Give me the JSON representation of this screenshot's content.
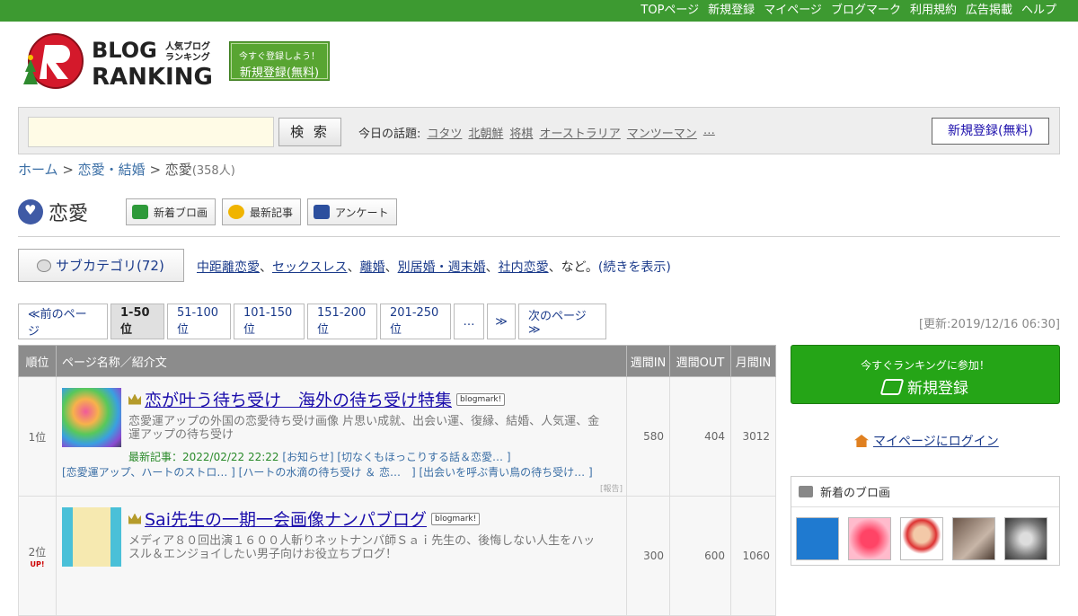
{
  "topnav": [
    "TOPページ",
    "新規登録",
    "マイページ",
    "ブログマーク",
    "利用規約",
    "広告掲載",
    "ヘルプ"
  ],
  "logo": {
    "line1": "BLOG",
    "line2": "RANKING",
    "sub1": "人気ブログ",
    "sub2": "ランキング"
  },
  "promo": {
    "small": "今すぐ登録しよう！",
    "big": "新規登録(無料)"
  },
  "search": {
    "placeholder": "",
    "button": "検 索"
  },
  "topics": {
    "label": "今日の話題:",
    "items": [
      "コタツ",
      "北朝鮮",
      "将棋",
      "オーストラリア",
      "マンツーマン",
      "…"
    ]
  },
  "register_button": "新規登録(無料)",
  "breadcrumb": {
    "home": "ホーム",
    "sep": " > ",
    "parent": "恋愛・結婚",
    "current": "恋愛",
    "count": "(358人)"
  },
  "category": {
    "name": "恋愛",
    "buttons": [
      "新着ブロ画",
      "最新記事",
      "アンケート"
    ]
  },
  "subcategory": {
    "button": "サブカテゴリ(72)",
    "links": [
      "中距離恋愛",
      "セックスレス",
      "離婚",
      "別居婚・週末婚",
      "社内恋愛"
    ],
    "suffix": "、など。",
    "more": "(続きを表示)"
  },
  "pager": [
    "≪前のページ",
    "1-50位",
    "51-100位",
    "101-150位",
    "151-200位",
    "201-250位",
    "…",
    "≫",
    "次のページ≫"
  ],
  "updated": "[更新:2019/12/16 06:30]",
  "table": {
    "headers": [
      "順位",
      "ページ名称／紹介文",
      "週間IN",
      "週間OUT",
      "月間IN"
    ],
    "rows": [
      {
        "rank": "1位",
        "title": "恋が叶う待ち受け　海外の待ち受け特集",
        "badge": "blogmark!",
        "desc": "恋愛運アップの外国の恋愛待ち受け画像 片思い成就、出会い運、復縁、結婚、人気運、金運アップの待ち受け",
        "latest_label": "最新記事：2022/02/22 22:22",
        "latest_links": "[お知らせ] [切なくもほっこりする話＆恋愛… ]",
        "more_links": "[恋愛運アップ、ハートのストロ… ] [ハートの水滴の待ち受け ＆ 恋…　] [出会いを呼ぶ青い鳥の待ち受け… ]",
        "report": "[報告]",
        "week_in": "580",
        "week_out": "404",
        "month_in": "3012"
      },
      {
        "rank": "2位",
        "up": "UP!",
        "title": "Sai先生の一期一会画像ナンパブログ",
        "badge": "blogmark!",
        "desc": "メディア８０回出演１６００人斬りネットナンパ師Ｓａｉ先生の、後悔しない人生をハッスル＆エンジョイしたい男子向けお役立ちブログ！",
        "week_in": "300",
        "week_out": "600",
        "month_in": "1060"
      }
    ]
  },
  "side": {
    "join_small": "今すぐランキングに参加！",
    "join_big": "新規登録",
    "mypage_login": "マイページにログイン",
    "new_images_title": "新着のブロ画"
  },
  "colors": {
    "topbar": "#3d9a31",
    "join": "#25a517",
    "link": "#1a0dab"
  }
}
